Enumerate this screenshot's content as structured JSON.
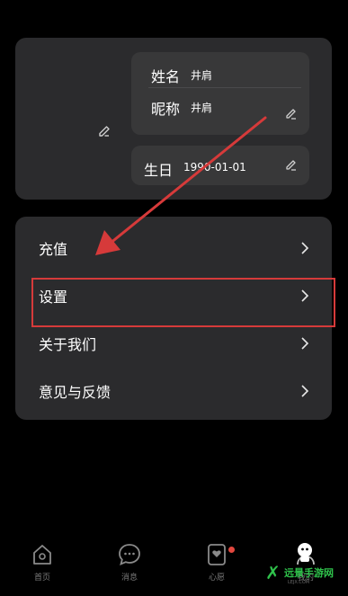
{
  "profile": {
    "name_label": "姓名",
    "name_value": "井肩",
    "nickname_label": "昵称",
    "nickname_value": "井肩",
    "birthday_label": "生日",
    "birthday_value": "1990-01-01"
  },
  "menu": {
    "items": [
      {
        "label": "充值"
      },
      {
        "label": "设置"
      },
      {
        "label": "关于我们"
      },
      {
        "label": "意见与反馈"
      }
    ]
  },
  "tabbar": {
    "tabs": [
      {
        "label": "首页",
        "icon": "home-icon"
      },
      {
        "label": "消息",
        "icon": "message-icon"
      },
      {
        "label": "心愿",
        "icon": "heart-card-icon"
      },
      {
        "label": "我的",
        "icon": "profile-icon"
      }
    ]
  },
  "watermark": {
    "name": "远景手游网",
    "sub": "LEJX.COM"
  },
  "colors": {
    "card": "#2b2b2d",
    "field": "#383839",
    "annotation": "#d63a3a",
    "badge": "#e3483f",
    "watermark": "#2fc14b"
  }
}
